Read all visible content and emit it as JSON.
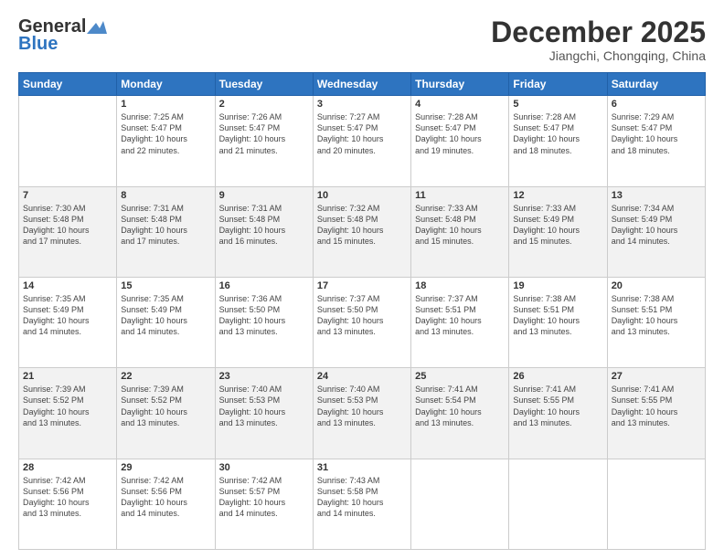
{
  "header": {
    "logo_general": "General",
    "logo_blue": "Blue",
    "month_title": "December 2025",
    "location": "Jiangchi, Chongqing, China"
  },
  "weekdays": [
    "Sunday",
    "Monday",
    "Tuesday",
    "Wednesday",
    "Thursday",
    "Friday",
    "Saturday"
  ],
  "weeks": [
    [
      {
        "day": "",
        "info": ""
      },
      {
        "day": "1",
        "info": "Sunrise: 7:25 AM\nSunset: 5:47 PM\nDaylight: 10 hours\nand 22 minutes."
      },
      {
        "day": "2",
        "info": "Sunrise: 7:26 AM\nSunset: 5:47 PM\nDaylight: 10 hours\nand 21 minutes."
      },
      {
        "day": "3",
        "info": "Sunrise: 7:27 AM\nSunset: 5:47 PM\nDaylight: 10 hours\nand 20 minutes."
      },
      {
        "day": "4",
        "info": "Sunrise: 7:28 AM\nSunset: 5:47 PM\nDaylight: 10 hours\nand 19 minutes."
      },
      {
        "day": "5",
        "info": "Sunrise: 7:28 AM\nSunset: 5:47 PM\nDaylight: 10 hours\nand 18 minutes."
      },
      {
        "day": "6",
        "info": "Sunrise: 7:29 AM\nSunset: 5:47 PM\nDaylight: 10 hours\nand 18 minutes."
      }
    ],
    [
      {
        "day": "7",
        "info": "Sunrise: 7:30 AM\nSunset: 5:48 PM\nDaylight: 10 hours\nand 17 minutes."
      },
      {
        "day": "8",
        "info": "Sunrise: 7:31 AM\nSunset: 5:48 PM\nDaylight: 10 hours\nand 17 minutes."
      },
      {
        "day": "9",
        "info": "Sunrise: 7:31 AM\nSunset: 5:48 PM\nDaylight: 10 hours\nand 16 minutes."
      },
      {
        "day": "10",
        "info": "Sunrise: 7:32 AM\nSunset: 5:48 PM\nDaylight: 10 hours\nand 15 minutes."
      },
      {
        "day": "11",
        "info": "Sunrise: 7:33 AM\nSunset: 5:48 PM\nDaylight: 10 hours\nand 15 minutes."
      },
      {
        "day": "12",
        "info": "Sunrise: 7:33 AM\nSunset: 5:49 PM\nDaylight: 10 hours\nand 15 minutes."
      },
      {
        "day": "13",
        "info": "Sunrise: 7:34 AM\nSunset: 5:49 PM\nDaylight: 10 hours\nand 14 minutes."
      }
    ],
    [
      {
        "day": "14",
        "info": "Sunrise: 7:35 AM\nSunset: 5:49 PM\nDaylight: 10 hours\nand 14 minutes."
      },
      {
        "day": "15",
        "info": "Sunrise: 7:35 AM\nSunset: 5:49 PM\nDaylight: 10 hours\nand 14 minutes."
      },
      {
        "day": "16",
        "info": "Sunrise: 7:36 AM\nSunset: 5:50 PM\nDaylight: 10 hours\nand 13 minutes."
      },
      {
        "day": "17",
        "info": "Sunrise: 7:37 AM\nSunset: 5:50 PM\nDaylight: 10 hours\nand 13 minutes."
      },
      {
        "day": "18",
        "info": "Sunrise: 7:37 AM\nSunset: 5:51 PM\nDaylight: 10 hours\nand 13 minutes."
      },
      {
        "day": "19",
        "info": "Sunrise: 7:38 AM\nSunset: 5:51 PM\nDaylight: 10 hours\nand 13 minutes."
      },
      {
        "day": "20",
        "info": "Sunrise: 7:38 AM\nSunset: 5:51 PM\nDaylight: 10 hours\nand 13 minutes."
      }
    ],
    [
      {
        "day": "21",
        "info": "Sunrise: 7:39 AM\nSunset: 5:52 PM\nDaylight: 10 hours\nand 13 minutes."
      },
      {
        "day": "22",
        "info": "Sunrise: 7:39 AM\nSunset: 5:52 PM\nDaylight: 10 hours\nand 13 minutes."
      },
      {
        "day": "23",
        "info": "Sunrise: 7:40 AM\nSunset: 5:53 PM\nDaylight: 10 hours\nand 13 minutes."
      },
      {
        "day": "24",
        "info": "Sunrise: 7:40 AM\nSunset: 5:53 PM\nDaylight: 10 hours\nand 13 minutes."
      },
      {
        "day": "25",
        "info": "Sunrise: 7:41 AM\nSunset: 5:54 PM\nDaylight: 10 hours\nand 13 minutes."
      },
      {
        "day": "26",
        "info": "Sunrise: 7:41 AM\nSunset: 5:55 PM\nDaylight: 10 hours\nand 13 minutes."
      },
      {
        "day": "27",
        "info": "Sunrise: 7:41 AM\nSunset: 5:55 PM\nDaylight: 10 hours\nand 13 minutes."
      }
    ],
    [
      {
        "day": "28",
        "info": "Sunrise: 7:42 AM\nSunset: 5:56 PM\nDaylight: 10 hours\nand 13 minutes."
      },
      {
        "day": "29",
        "info": "Sunrise: 7:42 AM\nSunset: 5:56 PM\nDaylight: 10 hours\nand 14 minutes."
      },
      {
        "day": "30",
        "info": "Sunrise: 7:42 AM\nSunset: 5:57 PM\nDaylight: 10 hours\nand 14 minutes."
      },
      {
        "day": "31",
        "info": "Sunrise: 7:43 AM\nSunset: 5:58 PM\nDaylight: 10 hours\nand 14 minutes."
      },
      {
        "day": "",
        "info": ""
      },
      {
        "day": "",
        "info": ""
      },
      {
        "day": "",
        "info": ""
      }
    ]
  ]
}
